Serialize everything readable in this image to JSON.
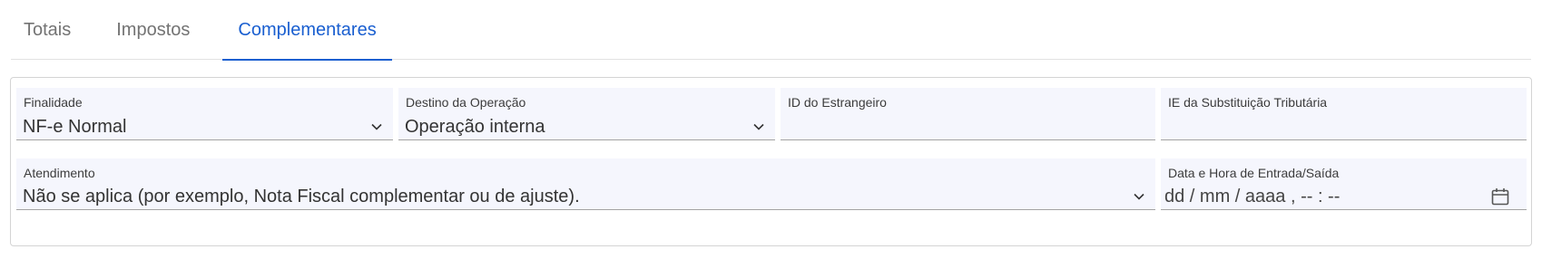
{
  "tabs": [
    {
      "label": "Totais",
      "active": false
    },
    {
      "label": "Impostos",
      "active": false
    },
    {
      "label": "Complementares",
      "active": true
    }
  ],
  "accent_color": "#1a5fd0",
  "fields": {
    "finalidade": {
      "label": "Finalidade",
      "value": "NF-e Normal",
      "type": "select"
    },
    "destino": {
      "label": "Destino da Operação",
      "value": "Operação interna",
      "type": "select"
    },
    "id_estrangeiro": {
      "label": "ID do Estrangeiro",
      "value": "",
      "type": "text"
    },
    "ie_st": {
      "label": "IE da Substituição Tributária",
      "value": "",
      "type": "text"
    },
    "atendimento": {
      "label": "Atendimento",
      "value": "Não se aplica (por exemplo, Nota Fiscal complementar ou de ajuste).",
      "type": "select"
    },
    "data_hora": {
      "label": "Data e Hora de Entrada/Saída",
      "value": "dd / mm / aaaa ,  -- : --",
      "type": "datetime-local"
    }
  },
  "icons": {
    "select": "chevron-down-icon",
    "datetime": "calendar-icon"
  }
}
